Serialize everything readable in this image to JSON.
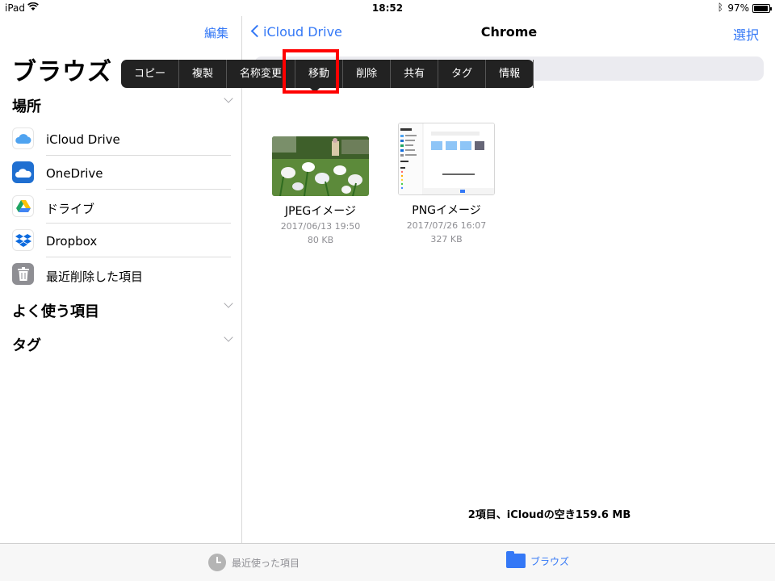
{
  "status": {
    "device": "iPad",
    "time": "18:52",
    "battery": "97%",
    "battery_level": 0.97
  },
  "sidebar": {
    "edit": "編集",
    "title": "ブラウズ",
    "locations_header": "場所",
    "items": [
      {
        "label": "iCloud Drive",
        "icon": "icloud-icon"
      },
      {
        "label": "OneDrive",
        "icon": "onedrive-icon"
      },
      {
        "label": "ドライブ",
        "icon": "google-drive-icon"
      },
      {
        "label": "Dropbox",
        "icon": "dropbox-icon"
      },
      {
        "label": "最近削除した項目",
        "icon": "trash-icon"
      }
    ],
    "favorites_header": "よく使う項目",
    "tags_header": "タグ"
  },
  "nav": {
    "back": "iCloud Drive",
    "title": "Chrome",
    "select": "選択"
  },
  "menu": {
    "items": [
      "コピー",
      "複製",
      "名称変更",
      "移動",
      "削除",
      "共有",
      "タグ",
      "情報"
    ]
  },
  "files": [
    {
      "name": "JPEGイメージ",
      "date": "2017/06/13 19:50",
      "size": "80 KB"
    },
    {
      "name": "PNGイメージ",
      "date": "2017/07/26 16:07",
      "size": "327 KB"
    }
  ],
  "footer_info": "2項目、iCloudの空き159.6 MB",
  "tabbar": {
    "recents": "最近使った項目",
    "browse": "ブラウズ"
  },
  "colors": {
    "accent": "#3478f6",
    "highlight": "#ff0000",
    "menu_bg": "#222222"
  }
}
